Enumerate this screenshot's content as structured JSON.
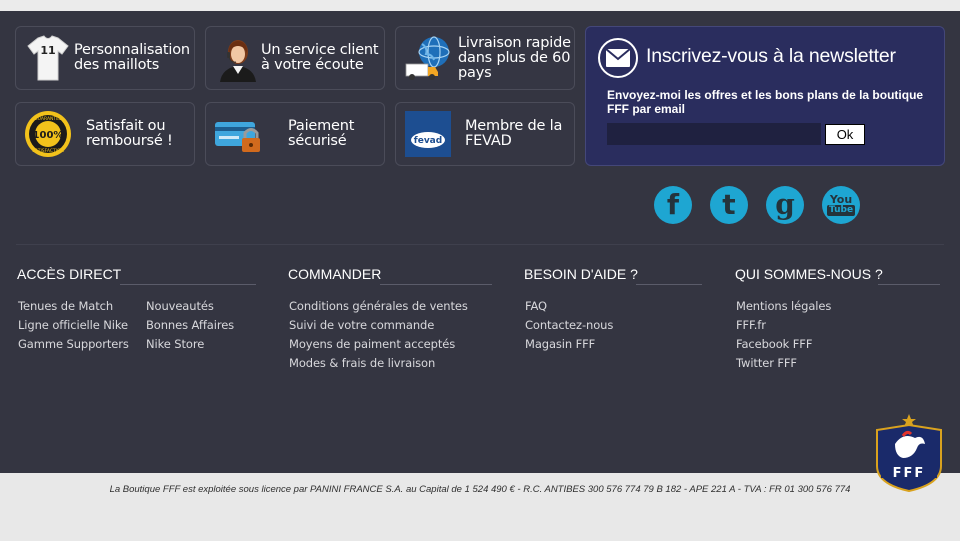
{
  "features": [
    {
      "label": "Personnalisation des maillots",
      "icon": "jersey-icon"
    },
    {
      "label": "Un service client à votre écoute",
      "icon": "customer-service-icon"
    },
    {
      "label": "Livraison rapide dans plus de 60 pays",
      "icon": "delivery-truck-globe-icon"
    },
    {
      "label": "Satisfait ou remboursé !",
      "icon": "satisfaction-guarantee-icon"
    },
    {
      "label": "Paiement sécurisé",
      "icon": "secure-payment-card-icon"
    },
    {
      "label": "Membre de la FEVAD",
      "icon": "fevad-logo-icon",
      "logo_text": "fevad"
    }
  ],
  "newsletter": {
    "title": "Inscrivez-vous à la newsletter",
    "description": "Envoyez-moi les offres et les bons plans de la boutique FFF par email",
    "email_value": "",
    "button_label": "Ok"
  },
  "social": [
    {
      "name": "facebook-icon",
      "glyph": "f"
    },
    {
      "name": "twitter-icon",
      "glyph": "t"
    },
    {
      "name": "google-icon",
      "glyph": "g"
    },
    {
      "name": "youtube-icon",
      "glyph_top": "You",
      "glyph_bottom": "Tube"
    }
  ],
  "columns": {
    "acces_direct": {
      "title": "ACCÈS DIRECT",
      "links_left": [
        "Tenues de Match",
        "Ligne officielle Nike",
        "Gamme Supporters"
      ],
      "links_right": [
        "Nouveautés",
        "Bonnes Affaires",
        "Nike Store"
      ]
    },
    "commander": {
      "title": "COMMANDER",
      "links": [
        "Conditions générales de ventes",
        "Suivi de votre commande",
        "Moyens de paiment acceptés",
        "Modes & frais de livraison"
      ]
    },
    "besoin_aide": {
      "title": "BESOIN D'AIDE ?",
      "links": [
        "FAQ",
        "Contactez-nous",
        "Magasin FFF"
      ]
    },
    "qui_sommes_nous": {
      "title": "QUI SOMMES-NOUS ?",
      "links": [
        "Mentions légales",
        "FFF.fr",
        "Facebook FFF",
        "Twitter FFF"
      ]
    }
  },
  "legal_text": "La Boutique FFF est exploitée sous licence par PANINI FRANCE S.A. au Capital de 1 524 490 € - R.C. ANTIBES 300 576 774 79 B 182 - APE 221 A - TVA : FR 01 300 576 774",
  "crest": {
    "letters": "FFF"
  },
  "colors": {
    "footer_bg": "#343541",
    "newsletter_bg": "#2a2d5e",
    "social_blue": "#1ea6d2",
    "bottom_bar": "#e8e8e8"
  }
}
